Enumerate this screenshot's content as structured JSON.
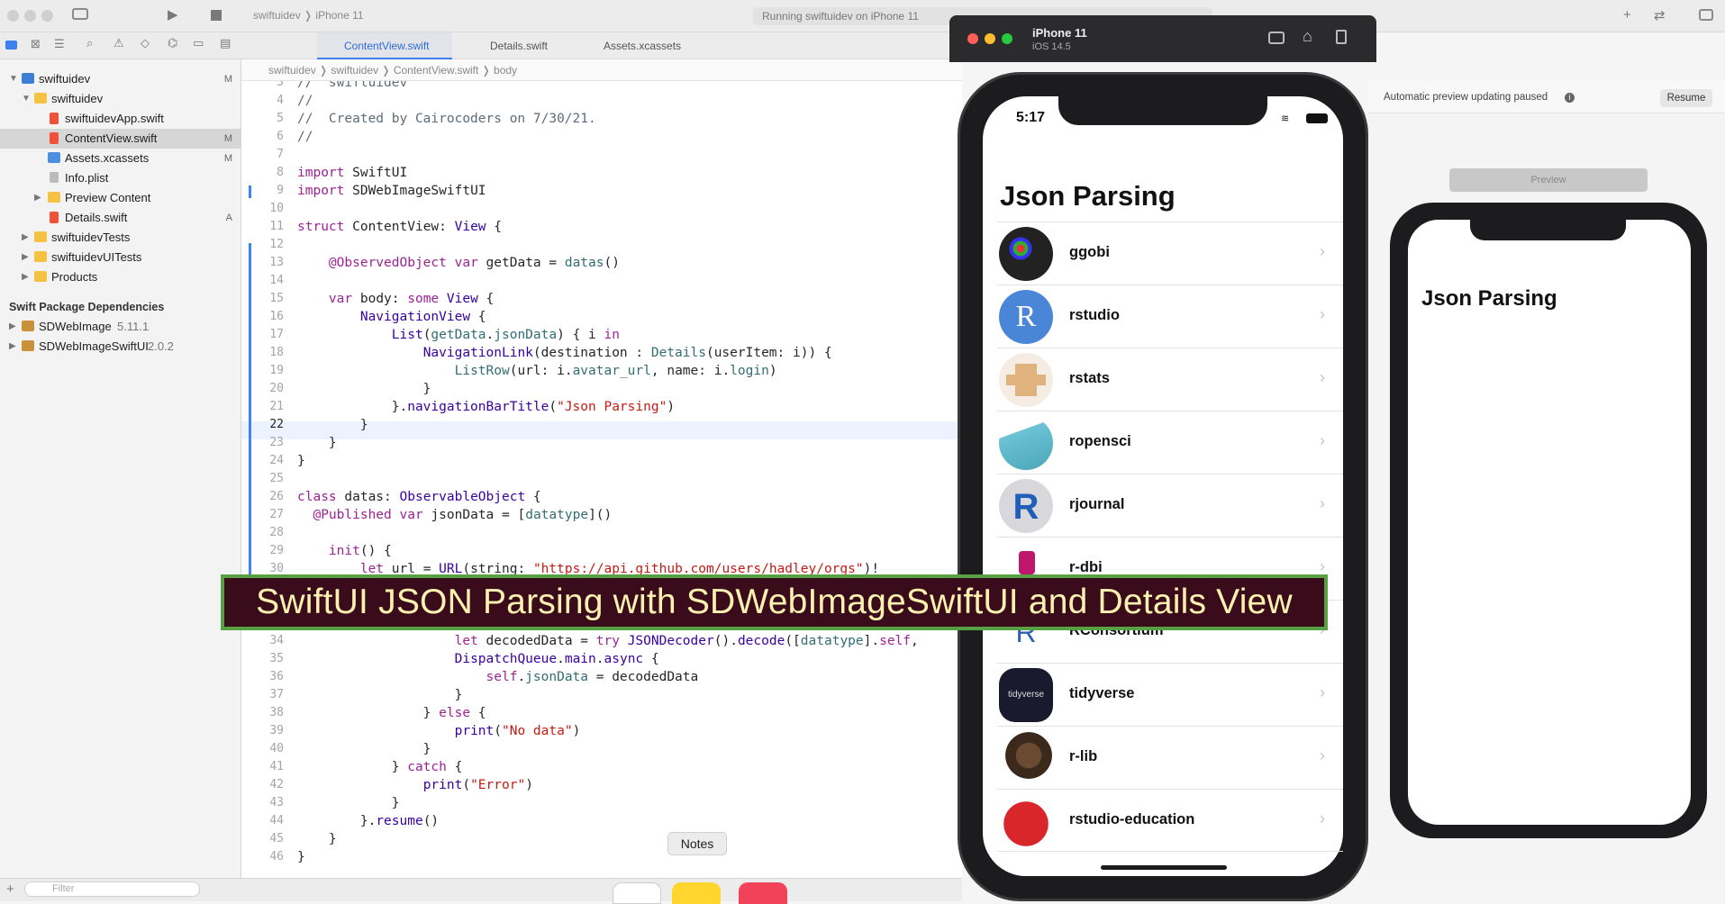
{
  "toolbar": {
    "scheme": "swiftuidev ❭ iPhone 11",
    "status": "Running swiftuidev on iPhone 11"
  },
  "tabs": [
    {
      "label": "ContentView.swift"
    },
    {
      "label": "Details.swift"
    },
    {
      "label": "Assets.xcassets"
    }
  ],
  "jumpbar": "swiftuidev  ❭  swiftuidev  ❭  ContentView.swift  ❭  body",
  "navigator": {
    "items": [
      {
        "label": "swiftuidev",
        "badge": "M"
      },
      {
        "label": "swiftuidev",
        "badge": ""
      },
      {
        "label": "swiftuidevApp.swift",
        "badge": ""
      },
      {
        "label": "ContentView.swift",
        "badge": "M"
      },
      {
        "label": "Assets.xcassets",
        "badge": "M"
      },
      {
        "label": "Info.plist",
        "badge": ""
      },
      {
        "label": "Preview Content",
        "badge": ""
      },
      {
        "label": "Details.swift",
        "badge": "A"
      },
      {
        "label": "swiftuidevTests",
        "badge": ""
      },
      {
        "label": "swiftuidevUITests",
        "badge": ""
      },
      {
        "label": "Products",
        "badge": ""
      }
    ],
    "section_title": "Swift Package Dependencies",
    "packages": [
      {
        "name": "SDWebImage",
        "version": "5.11.1"
      },
      {
        "name": "SDWebImageSwiftUI",
        "version": "2.0.2"
      }
    ],
    "filter_placeholder": "Filter"
  },
  "code": {
    "line_numbers": [
      "3",
      "4",
      "5",
      "6",
      "7",
      "8",
      "9",
      "10",
      "11",
      "12",
      "13",
      "14",
      "15",
      "16",
      "17",
      "18",
      "19",
      "20",
      "21",
      "22",
      "23",
      "24",
      "25",
      "26",
      "27",
      "28",
      "29",
      "30",
      "34",
      "35",
      "36",
      "37",
      "38",
      "39",
      "40",
      "41",
      "42",
      "43",
      "44",
      "45",
      "46"
    ],
    "current_line": "22"
  },
  "banner": {
    "text": "SwiftUI JSON Parsing with SDWebImageSwiftUI and Details View"
  },
  "simulator": {
    "device": "iPhone 11",
    "os": "iOS 14.5",
    "time": "5:17",
    "title": "Json Parsing",
    "rows": [
      {
        "name": "ggobi"
      },
      {
        "name": "rstudio"
      },
      {
        "name": "rstats"
      },
      {
        "name": "ropensci"
      },
      {
        "name": "rjournal"
      },
      {
        "name": "r-dbi"
      },
      {
        "name": "RConsortium"
      },
      {
        "name": "tidyverse"
      },
      {
        "name": "r-lib"
      },
      {
        "name": "rstudio-education"
      }
    ]
  },
  "canvas": {
    "paused": "Automatic preview updating paused",
    "resume": "Resume",
    "preview": "Preview",
    "title": "Json Parsing"
  },
  "tooltip": "Notes"
}
